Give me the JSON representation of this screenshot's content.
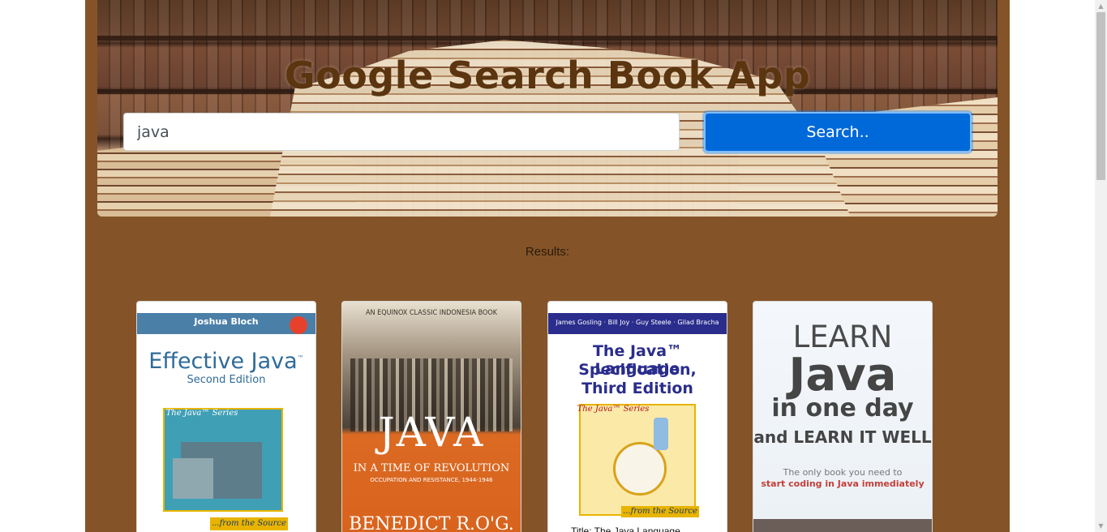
{
  "header": {
    "title": "Google Search Book App",
    "search_value": "java",
    "search_button": "Search.."
  },
  "results": {
    "label": "Results:"
  },
  "books": [
    {
      "author": "Joshua Bloch",
      "title": "Effective Java",
      "tm": "™",
      "subtitle": "Second Edition",
      "series": "The Java™ Series",
      "tagline": "...from the Source"
    },
    {
      "publisher_line": "AN EQUINOX CLASSIC INDONESIA BOOK",
      "title": "JAVA",
      "subtitle": "IN A TIME OF REVOLUTION",
      "sub_subtitle": "OCCUPATION AND RESISTANCE, 1944-1946",
      "author": "BENEDICT R.O'G."
    },
    {
      "authors": "James Gosling · Bill Joy · Guy Steele · Gilad Bracha",
      "title_line1": "The Java™ Language",
      "title_line2": "Specification,",
      "title_line3": "Third Edition",
      "series": "The Java™ Series",
      "tagline": "...from the Source",
      "caption": "Title: The Java Language..."
    },
    {
      "line1": "LEARN",
      "line2": "Java",
      "line3": "in one day",
      "line4": "and LEARN IT WELL",
      "tag1": "The only book you need to",
      "tag2": "start coding in Java immediately"
    }
  ],
  "colors": {
    "page_background": "#845428",
    "title": "#5a3510",
    "button": "#0069d9"
  }
}
